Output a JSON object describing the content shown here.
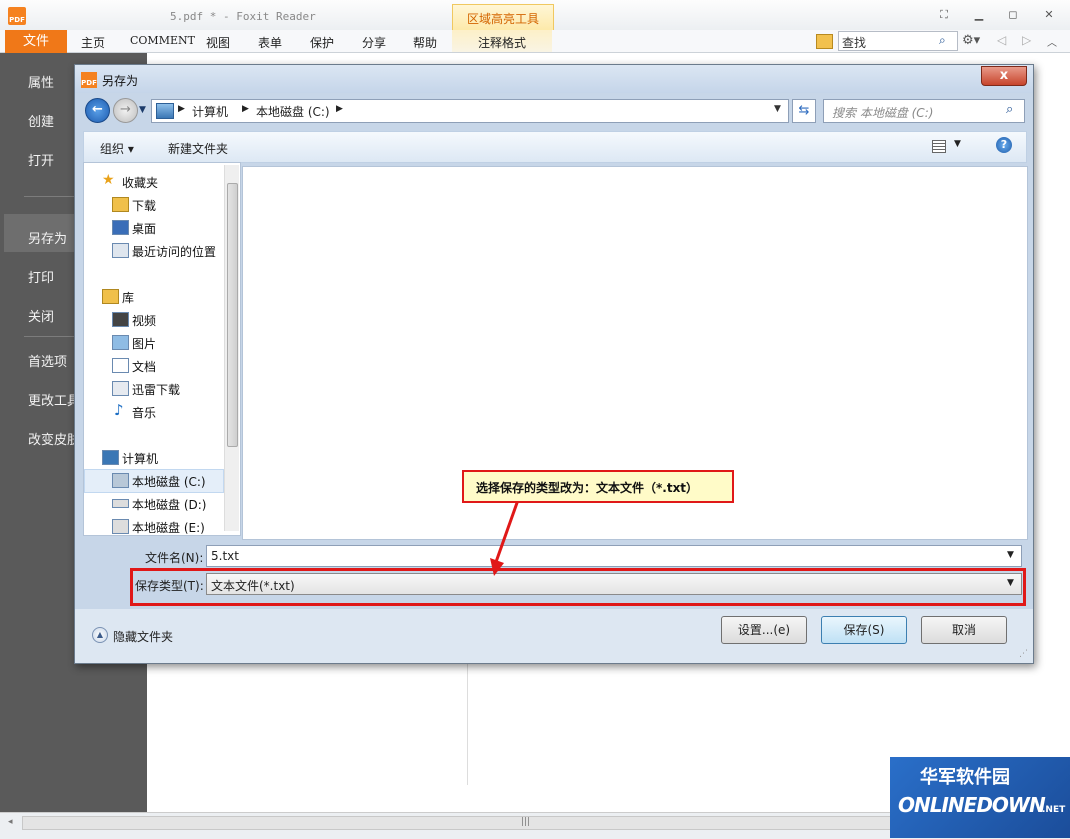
{
  "app": {
    "logo_text": "PDF",
    "window_title": "5.pdf * - Foxit Reader",
    "context_tab": "区域高亮工具",
    "context_menu": "注释格式",
    "search_value": "查找"
  },
  "menu": {
    "file": "文件",
    "items": [
      "主页",
      "COMMENT",
      "视图",
      "表单",
      "保护",
      "分享",
      "帮助"
    ]
  },
  "left_panel": {
    "items": [
      "属性",
      "创建",
      "打开",
      "另存为",
      "打印",
      "关闭",
      "首选项",
      "更改工具",
      "改变皮肤"
    ],
    "active": "另存为"
  },
  "dialog": {
    "logo_text": "PDF",
    "title": "另存为",
    "close_label": "x",
    "breadcrumb": [
      "计算机",
      "本地磁盘 (C:)"
    ],
    "search_placeholder": "搜索 本地磁盘 (C:)",
    "toolbar": {
      "organize": "组织 ▾",
      "new_folder": "新建文件夹",
      "help": "?"
    },
    "nav": {
      "favorites": "收藏夹",
      "favorites_items": [
        "下载",
        "桌面",
        "最近访问的位置"
      ],
      "libraries": "库",
      "library_items": [
        "视频",
        "图片",
        "文档",
        "迅雷下载",
        "音乐"
      ],
      "computer": "计算机",
      "drives": [
        "本地磁盘 (C:)",
        "本地磁盘 (D:)",
        "本地磁盘 (E:)"
      ]
    },
    "file_name_label": "文件名(N):",
    "file_name_value": "5.txt",
    "file_type_label": "保存类型(T):",
    "file_type_value": "文本文件(*.txt)",
    "hide_folders": "隐藏文件夹",
    "buttons": {
      "settings": "设置...(e)",
      "save": "保存(S)",
      "cancel": "取消"
    }
  },
  "callout": {
    "text": "选择保存的类型改为：文本文件（*.txt）"
  },
  "watermark": {
    "cn": "华军软件园",
    "en": "ONLINEDOWN",
    "suffix": ".NET"
  },
  "colors": {
    "accent": "#f07818",
    "highlight": "#e01818",
    "callout_bg": "#fffbc8"
  }
}
